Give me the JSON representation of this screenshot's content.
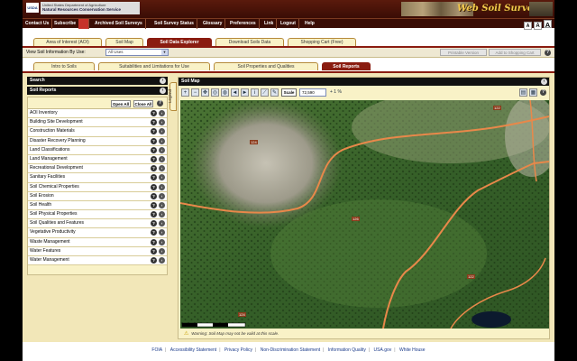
{
  "header": {
    "usda": "USDA",
    "agency_line1": "United States Department of Agriculture",
    "agency_line2": "Natural Resources Conservation Service",
    "brand": "Web Soil Survey"
  },
  "topnav": [
    "Contact Us",
    "Subscribe",
    "Archived Soil Surveys",
    "Soil Survey Status",
    "Glossary",
    "Preferences",
    "Link",
    "Logout",
    "Help"
  ],
  "font_sizes": [
    "A",
    "A",
    "A"
  ],
  "main_tabs": [
    "Area of Interest (AOI)",
    "Soil Map",
    "Soil Data Explorer",
    "Download Soils Data",
    "Shopping Cart (Free)"
  ],
  "main_tab_active": "Soil Data Explorer",
  "view_bar": {
    "label": "View Soil Information By Use:",
    "select_value": "All Uses",
    "printable": "Printable Version",
    "add_cart": "Add to Shopping Cart"
  },
  "sub_tabs": [
    "Intro to Soils",
    "Suitabilities and Limitations for Use",
    "Soil Properties and Qualities",
    "Soil Reports"
  ],
  "sub_tab_active": "Soil Reports",
  "left": {
    "search_title": "Search",
    "reports_title": "Soil Reports",
    "open_all": "Open All",
    "close_all": "Close All",
    "items": [
      "AOI Inventory",
      "Building Site Development",
      "Construction Materials",
      "Disaster Recovery Planning",
      "Land Classifications",
      "Land Management",
      "Recreational Development",
      "Sanitary Facilities",
      "Soil Chemical Properties",
      "Soil Erosion",
      "Soil Health",
      "Soil Physical Properties",
      "Soil Qualities and Features",
      "Vegetative Productivity",
      "Waste Management",
      "Water Features",
      "Water Management"
    ]
  },
  "map": {
    "legend_label": "Legend",
    "title": "Soil Map",
    "scale_btn": "Scale",
    "scale_value": "72,590",
    "zoom_text": "+ 1 %",
    "warning": "Warning: Soil Map may not be valid at this scale.",
    "unit_labels": [
      "124",
      "126",
      "122",
      "124",
      "122"
    ]
  },
  "footer": [
    "FOIA",
    "Accessibility Statement",
    "Privacy Policy",
    "Non-Discrimination Statement",
    "Information Quality",
    "USA.gov",
    "White House"
  ],
  "colors": {
    "brand_red": "#8a1c10",
    "tab_cream": "#f9f2c7",
    "boundary": "#e8884a"
  }
}
